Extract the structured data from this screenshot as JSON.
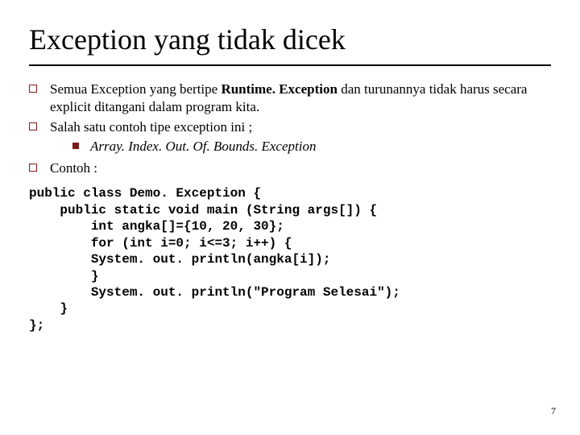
{
  "title": "Exception yang tidak dicek",
  "b1a": "Semua Exception yang bertipe ",
  "b1b": "Runtime. Exception",
  "b1c": " dan turunannya tidak harus secara explicit ditangani dalam program kita.",
  "b2": "Salah satu contoh tipe exception ini ;",
  "b2s": "Array. Index. Out. Of. Bounds. Exception",
  "b3": "Contoh :",
  "code": "public class Demo. Exception {\n    public static void main (String args[]) {\n        int angka[]={10, 20, 30};\n        for (int i=0; i<=3; i++) {\n        System. out. println(angka[i]);\n        }\n        System. out. println(\"Program Selesai\");\n    }\n};",
  "page": "7"
}
